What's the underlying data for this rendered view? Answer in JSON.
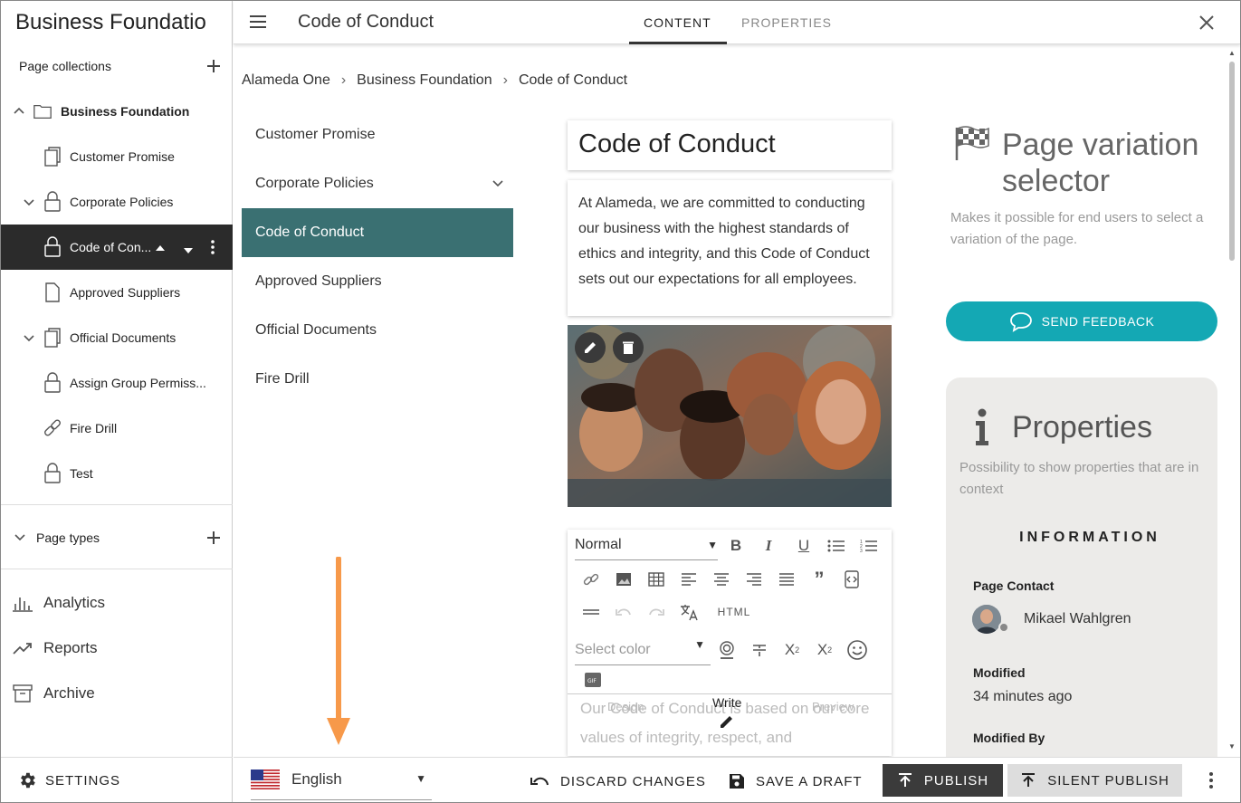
{
  "sidebar": {
    "title": "Business Foundatio",
    "collections_label": "Page collections",
    "tree": [
      {
        "label": "Business Foundation",
        "icon": "folder-icon",
        "chevron": "up"
      },
      {
        "label": "Customer Promise",
        "icon": "pages-icon"
      },
      {
        "label": "Corporate Policies",
        "icon": "lock-icon",
        "chevron": "down"
      },
      {
        "label": "Code of Con...",
        "icon": "lock-icon",
        "active": true
      },
      {
        "label": "Approved Suppliers",
        "icon": "page-icon"
      },
      {
        "label": "Official Documents",
        "icon": "pages-icon",
        "chevron": "down"
      },
      {
        "label": "Assign Group Permiss...",
        "icon": "lock-icon"
      },
      {
        "label": "Fire Drill",
        "icon": "link-icon"
      },
      {
        "label": "Test",
        "icon": "lock-icon"
      }
    ],
    "page_types_label": "Page types",
    "nav": [
      {
        "label": "Analytics",
        "icon": "analytics-icon"
      },
      {
        "label": "Reports",
        "icon": "trending-icon"
      },
      {
        "label": "Archive",
        "icon": "archive-icon"
      }
    ],
    "settings_label": "SETTINGS"
  },
  "topbar": {
    "title": "Code of Conduct",
    "tabs": [
      {
        "label": "CONTENT",
        "active": true
      },
      {
        "label": "PROPERTIES",
        "active": false
      }
    ]
  },
  "breadcrumb": [
    "Alameda One",
    "Business Foundation",
    "Code of Conduct"
  ],
  "page_nav": [
    {
      "label": "Customer Promise"
    },
    {
      "label": "Corporate Policies",
      "expandable": true
    },
    {
      "label": "Code of Conduct",
      "active": true
    },
    {
      "label": "Approved Suppliers"
    },
    {
      "label": "Official Documents"
    },
    {
      "label": "Fire Drill"
    }
  ],
  "editor": {
    "title": "Code of Conduct",
    "intro": "At Alameda, we are committed to conducting our business with the highest standards of ethics and integrity, and this Code of Conduct sets out our expectations for all employees.",
    "format_select": "Normal",
    "color_placeholder": "Select color",
    "html_label": "HTML",
    "body_text": "Our Code of Conduct is based on our core values of integrity, respect, and",
    "body_tabs": {
      "left": "Design",
      "center": "Write",
      "right": "Preview"
    }
  },
  "right_panel": {
    "pvs_title": "Page variation selector",
    "pvs_desc": "Makes it possible for end users to select a variation of the page.",
    "feedback_label": "SEND FEEDBACK",
    "props_title": "Properties",
    "props_desc": "Possibility to show properties that are in context",
    "info_heading": "INFORMATION",
    "page_contact_label": "Page Contact",
    "page_contact_name": "Mikael Wahlgren",
    "modified_label": "Modified",
    "modified_value": "34 minutes ago",
    "modified_by_label": "Modified By"
  },
  "bottombar": {
    "language": "English",
    "discard_label": "DISCARD CHANGES",
    "draft_label": "SAVE A DRAFT",
    "publish_label": "PUBLISH",
    "silent_publish_label": "SILENT PUBLISH"
  },
  "colors": {
    "active_nav": "#3a7072",
    "feedback": "#14a8b4",
    "arrow": "#f7994a",
    "dark": "#2b2b2b"
  }
}
